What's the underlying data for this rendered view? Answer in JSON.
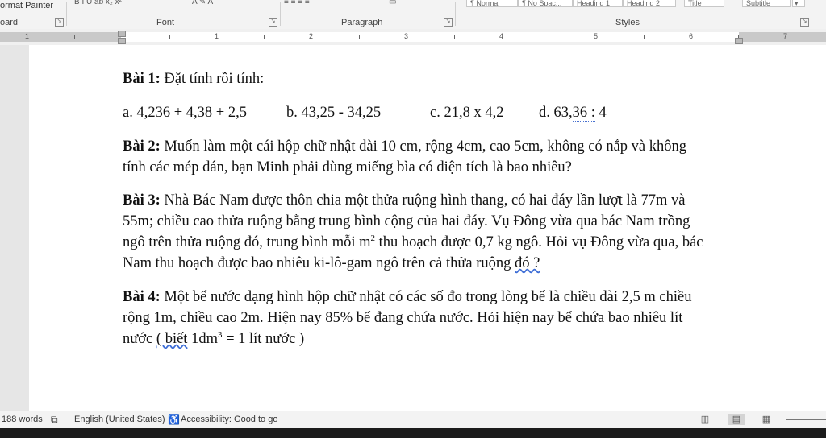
{
  "ribbon": {
    "format_painter_label": "ormat Painter",
    "clipboard_group": "oard",
    "font_group": "Font",
    "paragraph_group": "Paragraph",
    "styles_group": "Styles",
    "style_items": [
      "¶ Normal",
      "¶ No Spac...",
      "Heading 1",
      "Heading 2",
      "Title",
      "Subtitle"
    ]
  },
  "ruler": {
    "numbers": [
      "1",
      "1",
      "2",
      "3",
      "4",
      "5",
      "6",
      "7"
    ]
  },
  "document": {
    "bai1": {
      "label": "Bài 1:",
      "text": " Đặt tính rồi tính:"
    },
    "bai1_items": {
      "a": "a. 4,236 + 4,38 + 2,5",
      "b": "b. 43,25 - 34,25",
      "c": "c. 21,8 x 4,2",
      "d_prefix": "d. 63,",
      "d_underlined": "36 :",
      "d_suffix": " 4"
    },
    "bai2": {
      "label": "Bài 2:",
      "line1": " Muốn làm một cái hộp chữ nhật dài 10 cm, rộng 4cm, cao 5cm, không có nắp và không",
      "line2": "tính các mép dán, bạn Minh phải dùng miếng bìa có diện tích là bao nhiêu?"
    },
    "bai3": {
      "label": "Bài 3:",
      "line1": " Nhà Bác Nam được thôn chia một thửa ruộng hình thang, có hai đáy lần lượt là 77m và",
      "line2": "55m; chiều cao thửa ruộng bằng trung bình cộng của hai đáy. Vụ Đông vừa qua bác Nam trồng",
      "line3_a": "ngô trên thửa ruộng đó, trung bình mỗi m",
      "line3_sup": "2",
      "line3_b": " thu hoạch được 0,7 kg ngô. Hỏi vụ Đông vừa qua, bác",
      "line4_a": "Nam thu hoạch được bao nhiêu ki-lô-gam ngô trên cả thửa ruộng ",
      "line4_underlined": "đó ?"
    },
    "bai4": {
      "label": "Bài 4:",
      "line1": " Một bể nước dạng hình hộp chữ nhật có các số đo trong lòng bể là chiều dài 2,5 m chiều",
      "line2": "rộng 1m, chiều cao 2m. Hiện nay 85% bể đang chứa nước. Hỏi hiện nay bể chứa bao nhiêu lít",
      "line3_a": "nước ",
      "line3_underlined": "( biết",
      "line3_b": " 1dm",
      "line3_sup": "3",
      "line3_c": " = 1 lít nước )"
    }
  },
  "status": {
    "words": "188 words",
    "language": "English (United States)",
    "accessibility": "Accessibility: Good to go"
  }
}
